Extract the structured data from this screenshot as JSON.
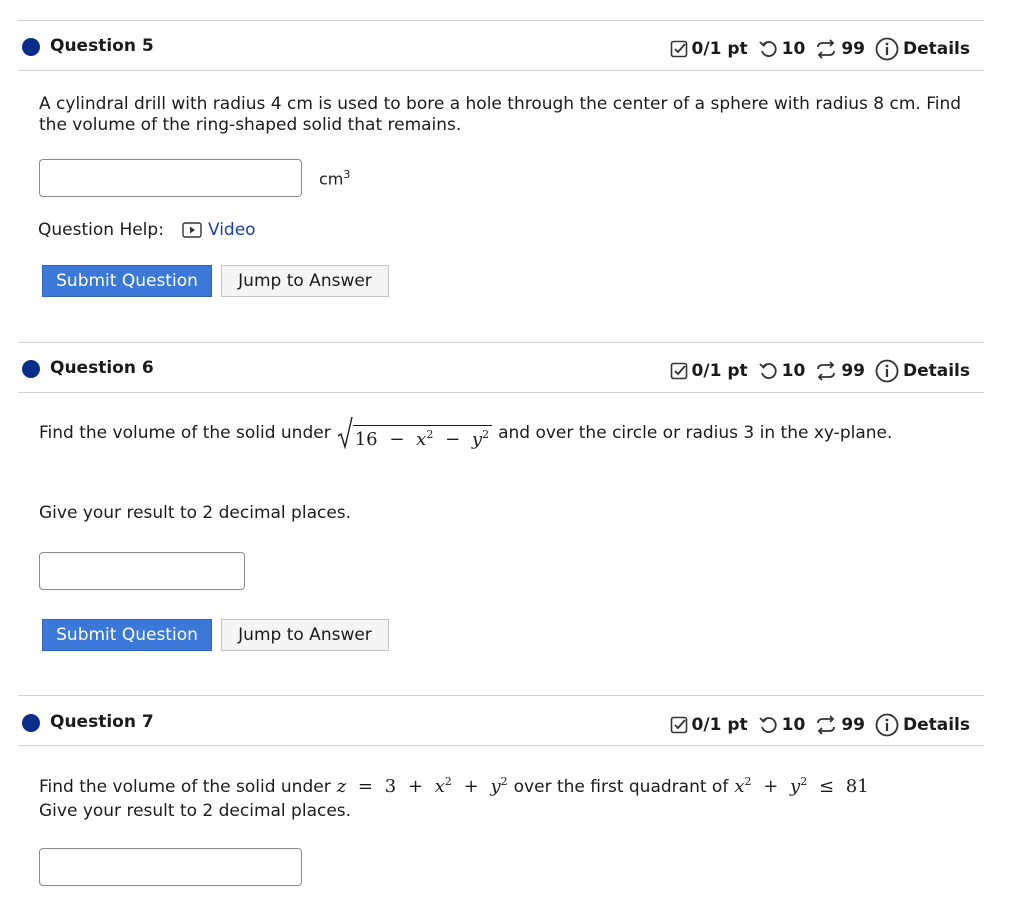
{
  "common": {
    "score": "0/1 pt",
    "retries": "10",
    "attempts": "99",
    "details": "Details",
    "submit": "Submit Question",
    "jump": "Jump to Answer"
  },
  "q5": {
    "title": "Question 5",
    "text_line1": "A cylindral drill with radius 4 cm is used to bore a hole through the center of a sphere with radius 8 cm. Find",
    "text_line2": "the volume of the ring-shaped solid that remains.",
    "unit_base": "cm",
    "unit_exp": "3",
    "help_label": "Question Help:",
    "video_label": "Video"
  },
  "q6": {
    "title": "Question 6",
    "text_pre": "Find the volume of the solid under",
    "sqrt_const": "16",
    "minus": "−",
    "var_x": "x",
    "var_y": "y",
    "exp": "2",
    "text_post": "and over the circle or radius 3 in the xy-plane.",
    "instruction": "Give your result to 2 decimal places."
  },
  "q7": {
    "title": "Question 7",
    "text_pre": "Find the volume of the solid under",
    "z": "z",
    "eq": "=",
    "c3": "3",
    "plus": "+",
    "x": "x",
    "y": "y",
    "exp": "2",
    "text_mid": "over the first quadrant of",
    "leq": "≤",
    "c81": "81",
    "instruction": "Give your result to 2 decimal places."
  }
}
